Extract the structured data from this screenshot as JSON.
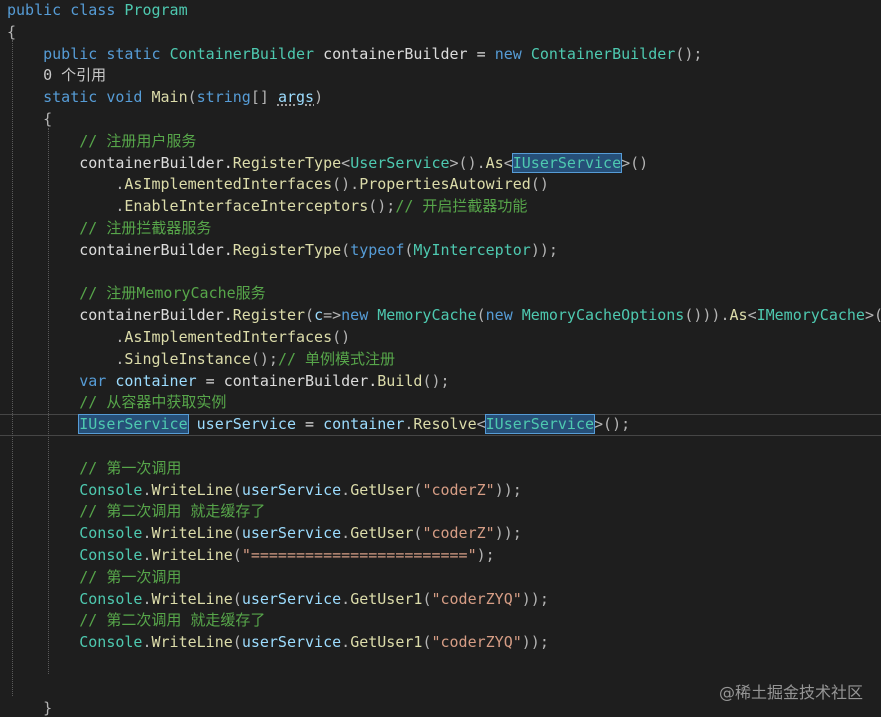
{
  "editor": {
    "lines": [
      [
        {
          "t": "public class ",
          "c": "kw"
        },
        {
          "t": "Program",
          "c": "type"
        }
      ],
      [
        {
          "t": "{",
          "c": "punct"
        }
      ],
      [
        {
          "t": "    public static ",
          "c": "kw"
        },
        {
          "t": "ContainerBuilder",
          "c": "type"
        },
        {
          "t": " containerBuilder = ",
          "c": "id"
        },
        {
          "t": "new ",
          "c": "kw"
        },
        {
          "t": "ContainerBuilder",
          "c": "type"
        },
        {
          "t": "();",
          "c": "punct"
        }
      ],
      [
        {
          "t": "    0 个引用",
          "c": "ref"
        }
      ],
      [
        {
          "t": "    static void ",
          "c": "kw"
        },
        {
          "t": "Main",
          "c": "method"
        },
        {
          "t": "(",
          "c": "punct"
        },
        {
          "t": "string",
          "c": "kw"
        },
        {
          "t": "[] ",
          "c": "punct"
        },
        {
          "t": "args",
          "c": "param",
          "sq": true
        },
        {
          "t": ")",
          "c": "punct"
        }
      ],
      [
        {
          "t": "    {",
          "c": "punct"
        }
      ],
      [
        {
          "t": "        // 注册用户服务",
          "c": "com"
        }
      ],
      [
        {
          "t": "        containerBuilder.",
          "c": "id"
        },
        {
          "t": "RegisterType",
          "c": "method"
        },
        {
          "t": "<",
          "c": "punct"
        },
        {
          "t": "UserService",
          "c": "type"
        },
        {
          "t": ">().",
          "c": "punct"
        },
        {
          "t": "As",
          "c": "method"
        },
        {
          "t": "<",
          "c": "punct"
        },
        {
          "t": "IUserService",
          "c": "hl"
        },
        {
          "t": ">()",
          "c": "punct"
        }
      ],
      [
        {
          "t": "            .",
          "c": "punct"
        },
        {
          "t": "AsImplementedInterfaces",
          "c": "method"
        },
        {
          "t": "().",
          "c": "punct"
        },
        {
          "t": "PropertiesAutowired",
          "c": "method"
        },
        {
          "t": "()",
          "c": "punct"
        }
      ],
      [
        {
          "t": "            .",
          "c": "punct"
        },
        {
          "t": "EnableInterfaceInterceptors",
          "c": "method"
        },
        {
          "t": "();",
          "c": "punct"
        },
        {
          "t": "// 开启拦截器功能",
          "c": "com"
        }
      ],
      [
        {
          "t": "        // 注册拦截器服务",
          "c": "com"
        }
      ],
      [
        {
          "t": "        containerBuilder.",
          "c": "id"
        },
        {
          "t": "RegisterType",
          "c": "method"
        },
        {
          "t": "(",
          "c": "punct"
        },
        {
          "t": "typeof",
          "c": "kw"
        },
        {
          "t": "(",
          "c": "punct"
        },
        {
          "t": "MyInterceptor",
          "c": "type"
        },
        {
          "t": "));",
          "c": "punct"
        }
      ],
      [],
      [
        {
          "t": "        // 注册MemoryCache服务",
          "c": "com"
        }
      ],
      [
        {
          "t": "        containerBuilder.",
          "c": "id"
        },
        {
          "t": "Register",
          "c": "method"
        },
        {
          "t": "(",
          "c": "punct"
        },
        {
          "t": "c",
          "c": "param"
        },
        {
          "t": "=>",
          "c": "punct"
        },
        {
          "t": "new ",
          "c": "kw"
        },
        {
          "t": "MemoryCache",
          "c": "type"
        },
        {
          "t": "(",
          "c": "punct"
        },
        {
          "t": "new ",
          "c": "kw"
        },
        {
          "t": "MemoryCacheOptions",
          "c": "type"
        },
        {
          "t": "())).",
          "c": "punct"
        },
        {
          "t": "As",
          "c": "method"
        },
        {
          "t": "<",
          "c": "punct"
        },
        {
          "t": "IMemoryCache",
          "c": "type"
        },
        {
          "t": ">()",
          "c": "punct"
        }
      ],
      [
        {
          "t": "            .",
          "c": "punct"
        },
        {
          "t": "AsImplementedInterfaces",
          "c": "method"
        },
        {
          "t": "()",
          "c": "punct"
        }
      ],
      [
        {
          "t": "            .",
          "c": "punct"
        },
        {
          "t": "SingleInstance",
          "c": "method"
        },
        {
          "t": "();",
          "c": "punct"
        },
        {
          "t": "// 单例模式注册",
          "c": "com"
        }
      ],
      [
        {
          "t": "        var ",
          "c": "kw"
        },
        {
          "t": "container",
          "c": "param"
        },
        {
          "t": " = containerBuilder.",
          "c": "id"
        },
        {
          "t": "Build",
          "c": "method"
        },
        {
          "t": "();",
          "c": "punct"
        }
      ],
      [
        {
          "t": "        // 从容器中获取实例",
          "c": "com"
        }
      ],
      [
        {
          "t": "        ",
          "c": "id"
        },
        {
          "t": "IUserService",
          "c": "hl"
        },
        {
          "t": " ",
          "c": "id"
        },
        {
          "t": "userService",
          "c": "param"
        },
        {
          "t": " = ",
          "c": "id"
        },
        {
          "t": "container",
          "c": "param"
        },
        {
          "t": ".",
          "c": "punct"
        },
        {
          "t": "Resolve",
          "c": "method"
        },
        {
          "t": "<",
          "c": "punct"
        },
        {
          "t": "IUserService",
          "c": "hl"
        },
        {
          "t": ">();",
          "c": "punct"
        }
      ],
      [],
      [
        {
          "t": "        // 第一次调用",
          "c": "com"
        }
      ],
      [
        {
          "t": "        ",
          "c": "id"
        },
        {
          "t": "Console",
          "c": "type"
        },
        {
          "t": ".",
          "c": "punct"
        },
        {
          "t": "WriteLine",
          "c": "method"
        },
        {
          "t": "(",
          "c": "punct"
        },
        {
          "t": "userService",
          "c": "param"
        },
        {
          "t": ".",
          "c": "punct"
        },
        {
          "t": "GetUser",
          "c": "method"
        },
        {
          "t": "(",
          "c": "punct"
        },
        {
          "t": "\"coderZ\"",
          "c": "str"
        },
        {
          "t": "));",
          "c": "punct"
        }
      ],
      [
        {
          "t": "        // 第二次调用 就走缓存了",
          "c": "com"
        }
      ],
      [
        {
          "t": "        ",
          "c": "id"
        },
        {
          "t": "Console",
          "c": "type"
        },
        {
          "t": ".",
          "c": "punct"
        },
        {
          "t": "WriteLine",
          "c": "method"
        },
        {
          "t": "(",
          "c": "punct"
        },
        {
          "t": "userService",
          "c": "param"
        },
        {
          "t": ".",
          "c": "punct"
        },
        {
          "t": "GetUser",
          "c": "method"
        },
        {
          "t": "(",
          "c": "punct"
        },
        {
          "t": "\"coderZ\"",
          "c": "str"
        },
        {
          "t": "));",
          "c": "punct"
        }
      ],
      [
        {
          "t": "        ",
          "c": "id"
        },
        {
          "t": "Console",
          "c": "type"
        },
        {
          "t": ".",
          "c": "punct"
        },
        {
          "t": "WriteLine",
          "c": "method"
        },
        {
          "t": "(",
          "c": "punct"
        },
        {
          "t": "\"========================\"",
          "c": "str"
        },
        {
          "t": ");",
          "c": "punct"
        }
      ],
      [
        {
          "t": "        // 第一次调用",
          "c": "com"
        }
      ],
      [
        {
          "t": "        ",
          "c": "id"
        },
        {
          "t": "Console",
          "c": "type"
        },
        {
          "t": ".",
          "c": "punct"
        },
        {
          "t": "WriteLine",
          "c": "method"
        },
        {
          "t": "(",
          "c": "punct"
        },
        {
          "t": "userService",
          "c": "param"
        },
        {
          "t": ".",
          "c": "punct"
        },
        {
          "t": "GetUser1",
          "c": "method"
        },
        {
          "t": "(",
          "c": "punct"
        },
        {
          "t": "\"coderZYQ\"",
          "c": "str"
        },
        {
          "t": "));",
          "c": "punct"
        }
      ],
      [
        {
          "t": "        // 第二次调用 就走缓存了",
          "c": "com"
        }
      ],
      [
        {
          "t": "        ",
          "c": "id"
        },
        {
          "t": "Console",
          "c": "type"
        },
        {
          "t": ".",
          "c": "punct"
        },
        {
          "t": "WriteLine",
          "c": "method"
        },
        {
          "t": "(",
          "c": "punct"
        },
        {
          "t": "userService",
          "c": "param"
        },
        {
          "t": ".",
          "c": "punct"
        },
        {
          "t": "GetUser1",
          "c": "method"
        },
        {
          "t": "(",
          "c": "punct"
        },
        {
          "t": "\"coderZYQ\"",
          "c": "str"
        },
        {
          "t": "));",
          "c": "punct"
        }
      ],
      [],
      [],
      [
        {
          "t": "    }",
          "c": "punct"
        }
      ],
      [
        {
          "t": "}",
          "c": "punct"
        }
      ]
    ]
  },
  "watermark": "@稀土掘金技术社区",
  "colors": {
    "background": "#1e1e1e",
    "keyword": "#569cd6",
    "type": "#4ec9b0",
    "method": "#dcdcaa",
    "comment": "#57a64a",
    "string": "#d69d85"
  }
}
